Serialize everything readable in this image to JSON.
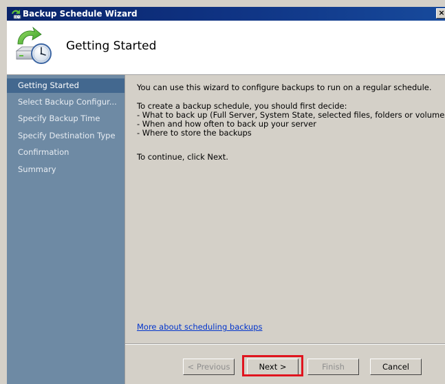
{
  "window": {
    "title": "Backup Schedule Wizard",
    "close_glyph": "×"
  },
  "header": {
    "title": "Getting Started",
    "icon": "backup-schedule-icon"
  },
  "sidebar": {
    "items": [
      {
        "label": "Getting Started",
        "active": true
      },
      {
        "label": "Select Backup Configur...",
        "active": false
      },
      {
        "label": "Specify Backup Time",
        "active": false
      },
      {
        "label": "Specify Destination Type",
        "active": false
      },
      {
        "label": "Confirmation",
        "active": false
      },
      {
        "label": "Summary",
        "active": false
      }
    ]
  },
  "content": {
    "intro": "You can use this wizard to configure backups to run on a regular schedule.",
    "decide_heading": "To create a backup schedule, you should first decide:",
    "decide_items": [
      "- What to back up (Full Server, System State, selected files, folders or volumes)",
      "- When and how often to back up your server",
      "- Where to store the backups"
    ],
    "continue_text": "To continue, click Next.",
    "more_link": "More about scheduling backups"
  },
  "buttons": {
    "previous": "< Previous",
    "next": "Next >",
    "finish": "Finish",
    "cancel": "Cancel"
  },
  "colors": {
    "title_bar": "#0a246a",
    "sidebar": "#6e8aa4",
    "sidebar_active": "#43688f",
    "dialog_face": "#d4d0c8",
    "link": "#0033cc",
    "highlight_box": "#e0141e"
  }
}
